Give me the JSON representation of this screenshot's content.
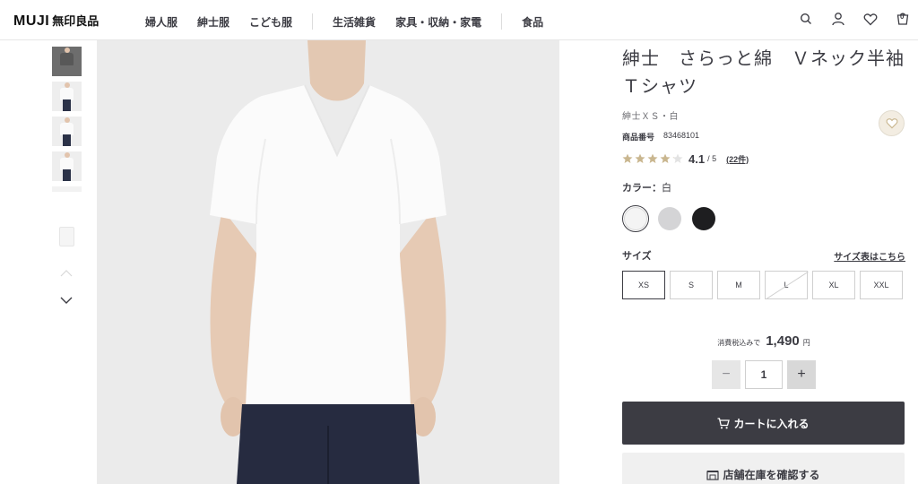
{
  "header": {
    "logo_latin": "MUJI",
    "logo_jp": "無印良品",
    "nav": [
      "婦人服",
      "紳士服",
      "こども服",
      "生活雑貨",
      "家具・収納・家電",
      "食品"
    ],
    "icons": [
      "search-icon",
      "account-icon",
      "heart-icon",
      "cart-icon"
    ],
    "cart_count": "0"
  },
  "gallery": {
    "thumbnail_count": 6,
    "icons": [
      "chevron-up-icon",
      "chevron-down-icon"
    ]
  },
  "product": {
    "title": "紳士　さらっと綿　Ｖネック半袖Ｔシャツ",
    "subtitle": "紳士ＸＳ・白",
    "product_no_label": "商品番号",
    "product_no": "83468101",
    "rating_value": "4.1",
    "rating_max": "/ 5",
    "rating_count": "(22件)",
    "rating_fraction": 0.82,
    "color_label": "カラー：",
    "color_value": "白",
    "swatch_colors": [
      "#f4f4f4",
      "#d4d4d6",
      "#1e1e20"
    ],
    "size_label": "サイズ",
    "size_guide": "サイズ表はこちら",
    "sizes": [
      "XS",
      "S",
      "M",
      "L",
      "XL",
      "XXL"
    ],
    "selected_size": "XS",
    "soldout_size": "L",
    "price_tax": "消費税込みで",
    "price": "1,490",
    "price_unit": "円",
    "qty_minus": "−",
    "qty_value": "1",
    "qty_plus": "+",
    "cart_button": "カートに入れる",
    "store_button": "店舗在庫を確認する"
  },
  "colors": {
    "text": "#3c3c43",
    "primary_button": "#3c3c43",
    "star": "#c9b68f"
  }
}
